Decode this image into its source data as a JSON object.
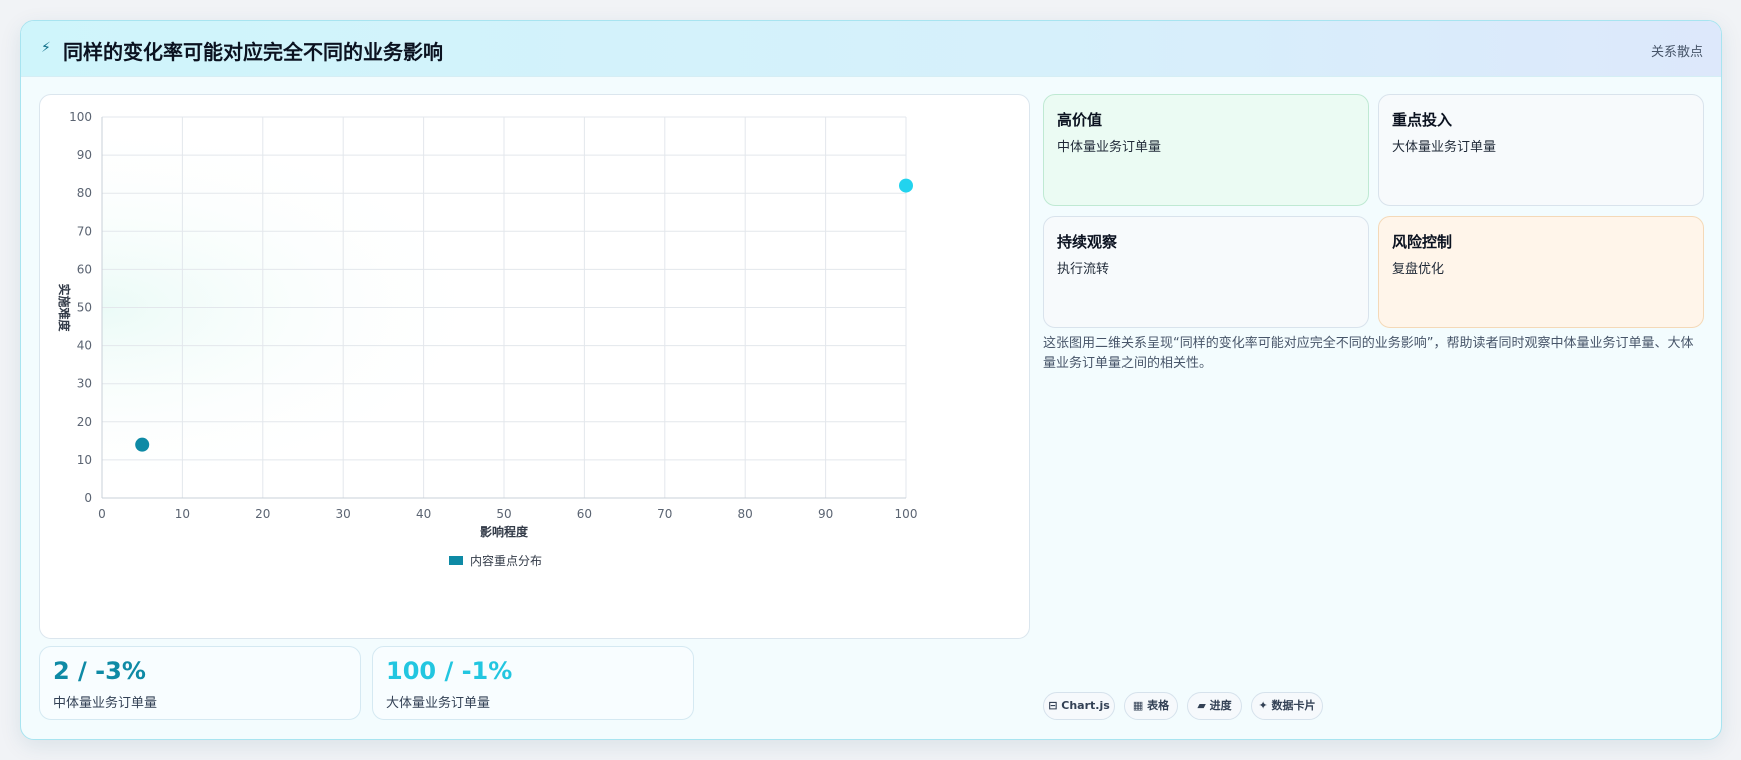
{
  "header": {
    "icon": "bolt-icon",
    "title": "同样的变化率可能对应完全不同的业务影响",
    "tag": "关系散点"
  },
  "chart_data": {
    "type": "scatter",
    "title": "",
    "xlabel": "影响程度",
    "ylabel": "实施难度",
    "xlim": [
      0,
      100
    ],
    "ylim": [
      0,
      100
    ],
    "xticks": [
      0,
      10,
      20,
      30,
      40,
      50,
      60,
      70,
      80,
      90,
      100
    ],
    "yticks": [
      0,
      10,
      20,
      30,
      40,
      50,
      60,
      70,
      80,
      90,
      100
    ],
    "grid": true,
    "legend_position": "bottom",
    "series": [
      {
        "name": "内容重点分布",
        "color": "#0e8aa5",
        "points": [
          {
            "x": 5,
            "y": 14,
            "color": "#0e8aa5"
          },
          {
            "x": 100,
            "y": 82,
            "color": "#22d3ee"
          }
        ]
      }
    ]
  },
  "stats": [
    {
      "value": "2 / -3%",
      "label": "中体量业务订单量",
      "color": "#0e8aa5"
    },
    {
      "value": "100 / -1%",
      "label": "大体量业务订单量",
      "color": "#22c6e0"
    }
  ],
  "quadrants": [
    {
      "title": "高价值",
      "subtitle": "中体量业务订单量",
      "bg": "#ebfbf3",
      "border": "#bfe9d3"
    },
    {
      "title": "重点投入",
      "subtitle": "大体量业务订单量",
      "bg": "#f7fafc",
      "border": "#d9e3ec"
    },
    {
      "title": "持续观察",
      "subtitle": "执行流转",
      "bg": "#f7fafc",
      "border": "#d9e3ec"
    },
    {
      "title": "风险控制",
      "subtitle": "复盘优化",
      "bg": "#fff5ea",
      "border": "#f4d9b8"
    }
  ],
  "description": "这张图用二维关系呈现“同样的变化率可能对应完全不同的业务影响”，帮助读者同时观察中体量业务订单量、大体量业务订单量之间的相关性。",
  "pills": [
    {
      "icon": "chart-icon",
      "glyph": "⊟",
      "label": "Chart.js"
    },
    {
      "icon": "table-icon",
      "glyph": "▦",
      "label": "表格"
    },
    {
      "icon": "progress-icon",
      "glyph": "▰",
      "label": "进度"
    },
    {
      "icon": "sparkle-icon",
      "glyph": "✦",
      "label": "数据卡片"
    }
  ]
}
